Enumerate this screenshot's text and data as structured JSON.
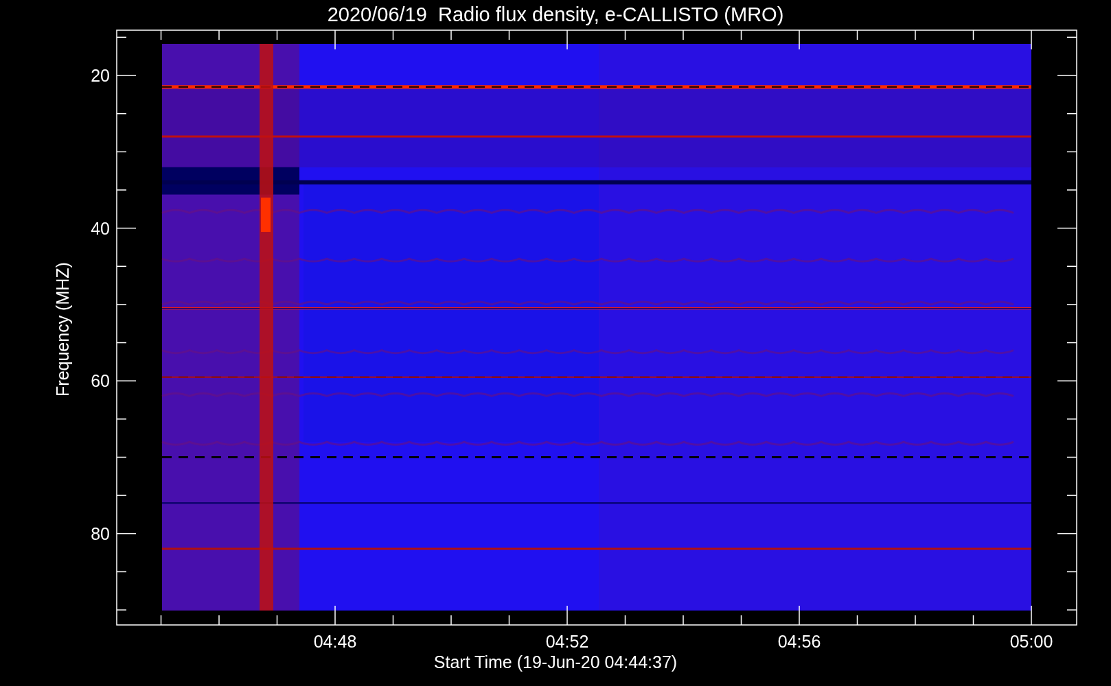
{
  "title": "2020/06/19  Radio flux density, e-CALLISTO (MRO)",
  "plot": {
    "y_axis": {
      "label": "Frequency (MHZ)",
      "ticks": [
        "20",
        "40",
        "60",
        "80"
      ]
    },
    "x_axis": {
      "label": "Start Time (19-Jun-20 04:44:37)",
      "ticks": [
        "04:48",
        "04:52",
        "04:56",
        "05:00"
      ]
    }
  }
}
